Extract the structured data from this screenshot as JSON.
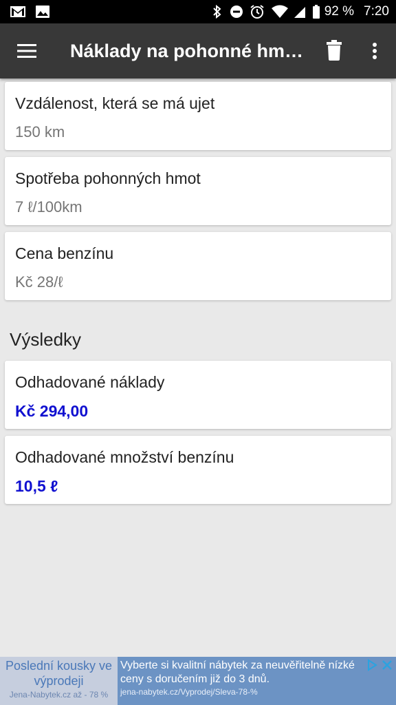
{
  "status_bar": {
    "battery_text": "92 %",
    "time": "7:20",
    "icons": [
      "gmail-icon",
      "gallery-icon",
      "bluetooth-icon",
      "do-not-disturb-icon",
      "alarm-icon",
      "wifi-icon",
      "cell-signal-icon",
      "battery-icon"
    ]
  },
  "app_bar": {
    "title": "Náklady na pohonné hmo...",
    "background": "#383838",
    "icons": [
      "menu-icon",
      "trash-icon",
      "more-vert-icon"
    ]
  },
  "inputs": [
    {
      "label": "Vzdálenost, která se má ujet",
      "placeholder": "150 km"
    },
    {
      "label": "Spotřeba pohonných hmot",
      "placeholder": "7 ℓ/100km"
    },
    {
      "label": "Cena benzínu",
      "placeholder": "Kč 28/ℓ"
    }
  ],
  "results": {
    "title": "Výsledky",
    "items": [
      {
        "label": "Odhadované náklady",
        "value": "Kč 294,00"
      },
      {
        "label": "Odhadované množství benzínu",
        "value": "10,5 ℓ"
      }
    ],
    "value_color": "#1010d0"
  },
  "ad": {
    "left_line1": "Poslední kousky ve",
    "left_line2": "výprodeji",
    "left_small": "Jena-Nabytek.cz až - 78 %",
    "headline": "Vyberte si kvalitní nábytek za neuvěřitelně nízké ceny s doručením již do 3 dnů.",
    "url": "jena-nabytek.cz/Vyprodej/Sleva-78-%",
    "icons": [
      "adchoices-icon",
      "close-ad-icon"
    ]
  }
}
